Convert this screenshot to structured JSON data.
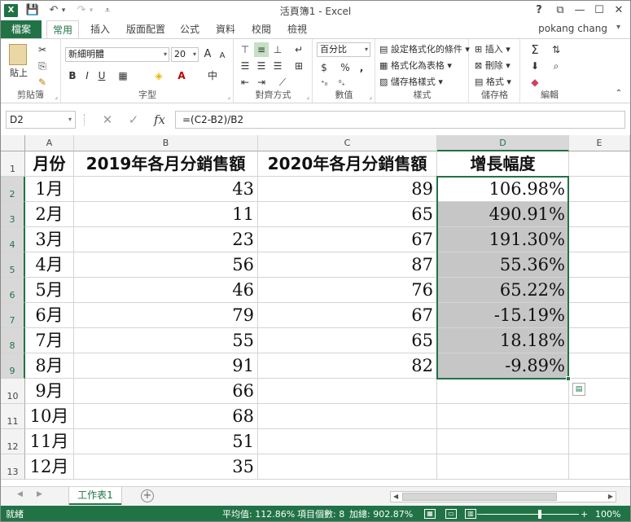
{
  "window": {
    "title": "活頁簿1 - Excel",
    "help": "?",
    "restore": "⧉",
    "minimize": "—",
    "maximize": "☐",
    "close": "✕"
  },
  "app_icon": "X",
  "qat": {
    "save": "💾",
    "undo": "↶",
    "undo_dd": "▾",
    "redo": "↷",
    "redo_dd": "▾",
    "customize": "⩡"
  },
  "tabs": [
    "檔案",
    "常用",
    "插入",
    "版面配置",
    "公式",
    "資料",
    "校閱",
    "檢視"
  ],
  "user": {
    "name": "pokang chang",
    "caret": "▾"
  },
  "ribbon": {
    "clipboard": {
      "label": "剪貼簿",
      "paste": "貼上"
    },
    "font": {
      "label": "字型",
      "name": "新細明體",
      "size": "20",
      "grow": "A",
      "shrink": "A",
      "bold": "B",
      "italic": "I",
      "underline": "U",
      "phonetic": "中"
    },
    "alignment": {
      "label": "對齊方式"
    },
    "number": {
      "label": "數值",
      "format": "百分比",
      "currency": "$",
      "percent": "%",
      "comma": ","
    },
    "styles": {
      "label": "樣式",
      "cond": "設定格式化的條件",
      "table": "格式化為表格",
      "cell": "儲存格樣式"
    },
    "cells": {
      "label": "儲存格",
      "insert": "插入",
      "delete": "刪除",
      "format": "格式"
    },
    "editing": {
      "label": "編輯"
    }
  },
  "formula_bar": {
    "name_box": "D2",
    "cancel": "✕",
    "enter": "✓",
    "fx": "fx",
    "formula": "=(C2-B2)/B2"
  },
  "columns": [
    "A",
    "B",
    "C",
    "D",
    "E"
  ],
  "rows": [
    "1",
    "2",
    "3",
    "4",
    "5",
    "6",
    "7",
    "8",
    "9",
    "10",
    "11",
    "12",
    "13"
  ],
  "table": {
    "headers": [
      "月份",
      "2019年各月分銷售額",
      "2020年各月分銷售額",
      "增長幅度"
    ],
    "data": [
      [
        "1月",
        "43",
        "89",
        "106.98%"
      ],
      [
        "2月",
        "11",
        "65",
        "490.91%"
      ],
      [
        "3月",
        "23",
        "67",
        "191.30%"
      ],
      [
        "4月",
        "56",
        "87",
        "55.36%"
      ],
      [
        "5月",
        "46",
        "76",
        "65.22%"
      ],
      [
        "6月",
        "79",
        "67",
        "-15.19%"
      ],
      [
        "7月",
        "55",
        "65",
        "18.18%"
      ],
      [
        "8月",
        "91",
        "82",
        "-9.89%"
      ],
      [
        "9月",
        "66",
        "",
        ""
      ],
      [
        "10月",
        "68",
        "",
        ""
      ],
      [
        "11月",
        "51",
        "",
        ""
      ],
      [
        "12月",
        "35",
        "",
        ""
      ]
    ]
  },
  "sheet": {
    "tab": "工作表1",
    "add": "+",
    "nav_left": "◀",
    "nav_right": "▶"
  },
  "status": {
    "ready": "就緒",
    "average": "平均值: 112.86%",
    "count": "項目個數: 8",
    "sum": "加總: 902.87%",
    "zoom": "100%",
    "zoom_minus": "−",
    "zoom_plus": "+"
  }
}
